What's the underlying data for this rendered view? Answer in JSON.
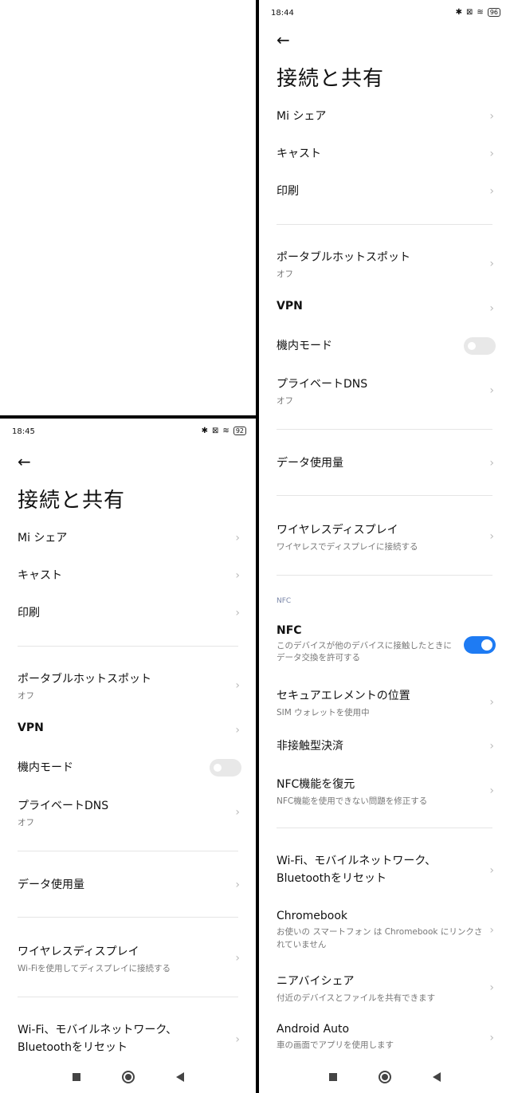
{
  "right": {
    "time": "18:44",
    "battery": "96",
    "title": "接続と共有",
    "items": [
      {
        "label": "Mi シェア"
      },
      {
        "label": "キャスト"
      },
      {
        "label": "印刷"
      },
      {
        "label": "ポータブルホットスポット",
        "sub": "オフ"
      },
      {
        "label": "VPN"
      },
      {
        "label": "機内モード"
      },
      {
        "label": "プライベートDNS",
        "sub": "オフ"
      },
      {
        "label": "データ使用量"
      },
      {
        "label": "ワイヤレスディスプレイ",
        "sub": "ワイヤレスでディスプレイに接続する"
      },
      {
        "label": "NFC",
        "sub": "このデバイスが他のデバイスに接触したときにデータ交換を許可する"
      },
      {
        "label": "セキュアエレメントの位置",
        "sub": "SIM ウォレットを使用中"
      },
      {
        "label": "非接触型決済"
      },
      {
        "label": "NFC機能を復元",
        "sub": "NFC機能を使用できない問題を修正する"
      },
      {
        "label": "Wi-Fi、モバイルネットワーク、Bluetoothをリセット"
      },
      {
        "label": "Chromebook",
        "sub": "お使いの スマートフォン は Chromebook にリンクされていません"
      },
      {
        "label": "ニアバイシェア",
        "sub": "付近のデバイスとファイルを共有できます"
      },
      {
        "label": "Android Auto",
        "sub": "車の画面でアプリを使用します"
      }
    ],
    "section_nfc": "NFC"
  },
  "left": {
    "time": "18:45",
    "battery": "92",
    "title": "接続と共有",
    "items": [
      {
        "label": "Mi シェア"
      },
      {
        "label": "キャスト"
      },
      {
        "label": "印刷"
      },
      {
        "label": "ポータブルホットスポット",
        "sub": "オフ"
      },
      {
        "label": "VPN"
      },
      {
        "label": "機内モード"
      },
      {
        "label": "プライベートDNS",
        "sub": "オフ"
      },
      {
        "label": "データ使用量"
      },
      {
        "label": "ワイヤレスディスプレイ",
        "sub": "Wi-Fiを使用してディスプレイに接続する"
      },
      {
        "label": "Wi-Fi、モバイルネットワーク、Bluetoothをリセット"
      }
    ]
  },
  "icons": {
    "chevron": "›",
    "back": "←",
    "bluetooth": "✱",
    "wifi": "≋"
  },
  "toggles": {
    "airplane_mode": false,
    "nfc": true
  }
}
